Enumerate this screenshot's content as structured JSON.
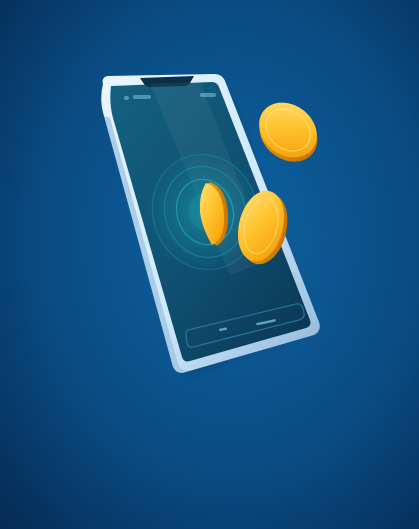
{
  "colors": {
    "background_center": "#0d63a3",
    "background_edge": "#052d57",
    "phone_frame": "#cfe9ff",
    "phone_frame_shadow": "#8fb6d6",
    "phone_screen_top": "#0f4e70",
    "phone_screen_bottom": "#0a3552",
    "hologram_glow": "#1aa6b0",
    "coin_light": "#ffd24d",
    "coin_mid": "#ffb21a",
    "coin_dark": "#e98a00"
  },
  "icons": {
    "phone": "smartphone-icon",
    "coin": "gold-coin-icon",
    "hologram": "hologram-rings-icon"
  }
}
